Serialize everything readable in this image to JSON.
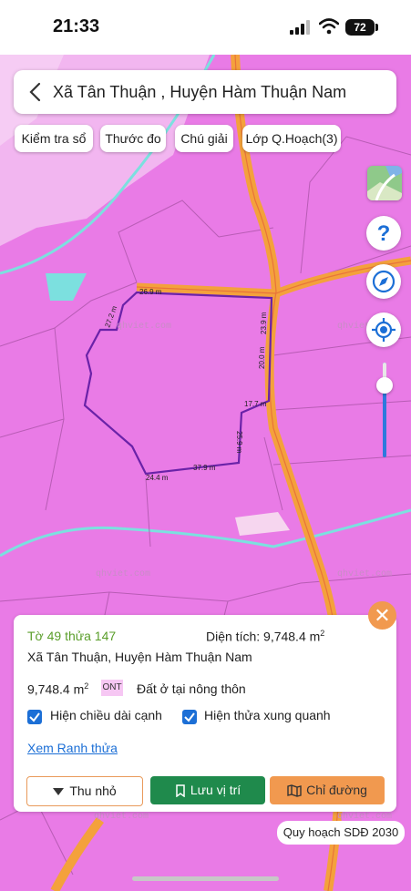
{
  "status": {
    "time": "21:33",
    "battery": "72"
  },
  "search": {
    "title": "Xã Tân Thuận , Huyện Hàm Thuận Nam"
  },
  "toolbar": {
    "check": "Kiểm tra sổ",
    "measure": "Thước đo",
    "legend": "Chú giải",
    "layer": "Lớp Q.Hoạch(3)"
  },
  "map": {
    "watermarks": [
      "qhviet.com",
      "qhviet.com",
      "qhviet.com",
      "qhviet.com",
      "qhviet.com",
      "qhviet.com"
    ],
    "edge_labels": [
      "26.9 m",
      "27.2 m",
      "23.9 m",
      "20.0 m",
      "17.7 m",
      "25.9 m",
      "37.9 m",
      "24.4 m"
    ]
  },
  "panel": {
    "sheet": "Tờ 49 thửa 147",
    "area_label": "Diện tích: 9,748.4 m",
    "area_sup": "2",
    "location": "Xã Tân Thuận, Huyện Hàm Thuận Nam",
    "area_value": "9,748.4 m",
    "area_value_sup": "2",
    "land_code": "ONT",
    "land_desc": "Đất ở tại nông thôn",
    "check_edges": "Hiện chiều dài cạnh",
    "check_neighbors": "Hiện thửa xung quanh",
    "boundary_link": "Xem Ranh thửa",
    "btn_collapse": "Thu nhỏ",
    "btn_save": "Lưu vị trí",
    "btn_directions": "Chỉ đường"
  },
  "footer": {
    "plan": "Quy hoạch SDĐ 2030"
  },
  "colors": {
    "land": "#e97be6",
    "road": "#f4a13c",
    "parcel": "#6a22a8",
    "blue": "#1c6fd6",
    "green_btn": "#1f8a4c",
    "orange_btn": "#f1994f",
    "teal": "#7ce0df"
  },
  "icons": [
    "back-arrow-icon",
    "map-layers-icon",
    "help-icon",
    "compass-icon",
    "locate-icon",
    "close-icon",
    "chevron-down-icon",
    "bookmark-icon",
    "map-icon"
  ]
}
